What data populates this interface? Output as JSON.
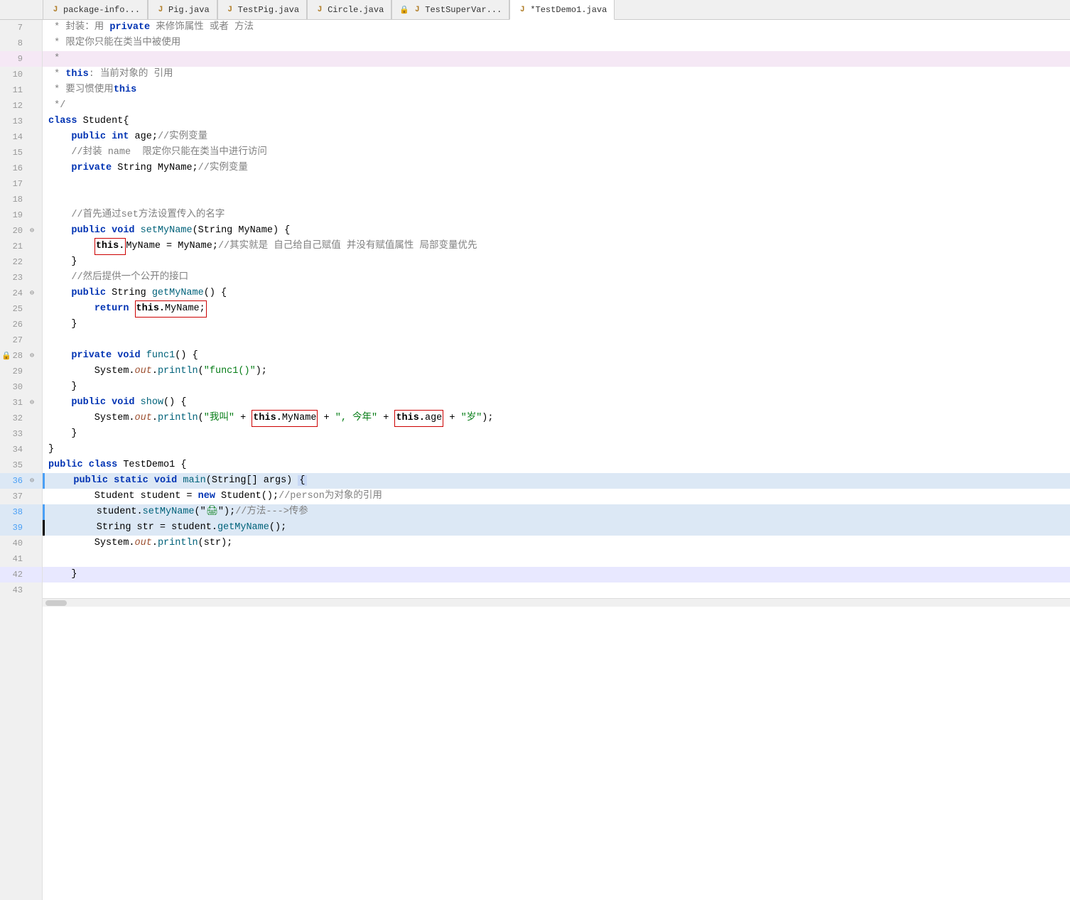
{
  "tabs": [
    {
      "id": "package-info",
      "label": "package-info...",
      "icon": "java",
      "active": false
    },
    {
      "id": "pig-java",
      "label": "Pig.java",
      "icon": "java",
      "active": false
    },
    {
      "id": "testpig-java",
      "label": "TestPig.java",
      "icon": "java",
      "active": false
    },
    {
      "id": "circle-java",
      "label": "Circle.java",
      "icon": "java",
      "active": false
    },
    {
      "id": "testsupervar",
      "label": "TestSuperVar...",
      "icon": "java-lock",
      "active": false
    },
    {
      "id": "testdemo1-java",
      "label": "*TestDemo1.java",
      "icon": "java",
      "active": true
    }
  ],
  "lines": [
    {
      "num": 7,
      "fold": "",
      "content": "comment_line_7",
      "type": "comment"
    },
    {
      "num": 8,
      "fold": "",
      "content": "comment_line_8",
      "type": "comment"
    },
    {
      "num": 9,
      "fold": "",
      "content": "comment_line_9",
      "type": "comment"
    },
    {
      "num": 10,
      "fold": "",
      "content": "comment_line_10",
      "type": "comment"
    },
    {
      "num": 11,
      "fold": "",
      "content": "comment_line_11",
      "type": "comment"
    },
    {
      "num": 12,
      "fold": "",
      "content": "comment_line_12",
      "type": "comment"
    },
    {
      "num": 13,
      "fold": "",
      "content": "code_line_13",
      "type": "code"
    },
    {
      "num": 14,
      "fold": "",
      "content": "code_line_14",
      "type": "code"
    },
    {
      "num": 15,
      "fold": "",
      "content": "code_line_15",
      "type": "comment"
    },
    {
      "num": 16,
      "fold": "",
      "content": "code_line_16",
      "type": "code"
    },
    {
      "num": 17,
      "fold": "",
      "content": "",
      "type": "blank"
    },
    {
      "num": 18,
      "fold": "",
      "content": "",
      "type": "blank"
    },
    {
      "num": 19,
      "fold": "",
      "content": "comment_line_19",
      "type": "comment"
    },
    {
      "num": 20,
      "fold": "⊖",
      "content": "code_line_20",
      "type": "code"
    },
    {
      "num": 21,
      "fold": "",
      "content": "code_line_21",
      "type": "code"
    },
    {
      "num": 22,
      "fold": "",
      "content": "code_line_22",
      "type": "code"
    },
    {
      "num": 23,
      "fold": "",
      "content": "comment_line_23",
      "type": "comment"
    },
    {
      "num": 24,
      "fold": "⊖",
      "content": "code_line_24",
      "type": "code"
    },
    {
      "num": 25,
      "fold": "",
      "content": "code_line_25",
      "type": "code"
    },
    {
      "num": 26,
      "fold": "",
      "content": "code_line_26",
      "type": "code"
    },
    {
      "num": 27,
      "fold": "",
      "content": "",
      "type": "blank"
    },
    {
      "num": 28,
      "fold": "⊖",
      "content": "code_line_28",
      "type": "code",
      "warn": true
    },
    {
      "num": 29,
      "fold": "",
      "content": "code_line_29",
      "type": "code"
    },
    {
      "num": 30,
      "fold": "",
      "content": "code_line_30",
      "type": "code"
    },
    {
      "num": 31,
      "fold": "⊖",
      "content": "code_line_31",
      "type": "code"
    },
    {
      "num": 32,
      "fold": "",
      "content": "code_line_32",
      "type": "code"
    },
    {
      "num": 33,
      "fold": "",
      "content": "code_line_33",
      "type": "code"
    },
    {
      "num": 34,
      "fold": "",
      "content": "code_line_34",
      "type": "code"
    },
    {
      "num": 35,
      "fold": "",
      "content": "code_line_35",
      "type": "code"
    },
    {
      "num": 36,
      "fold": "⊖",
      "content": "code_line_36",
      "type": "code",
      "highlight": true
    },
    {
      "num": 37,
      "fold": "",
      "content": "code_line_37",
      "type": "code"
    },
    {
      "num": 38,
      "fold": "",
      "content": "code_line_38",
      "type": "code",
      "blueline": true
    },
    {
      "num": 39,
      "fold": "",
      "content": "code_line_39",
      "type": "code",
      "blackline": true
    },
    {
      "num": 40,
      "fold": "",
      "content": "code_line_40",
      "type": "code"
    },
    {
      "num": 41,
      "fold": "",
      "content": "",
      "type": "blank"
    },
    {
      "num": 42,
      "fold": "",
      "content": "code_line_42",
      "type": "code",
      "highlight": true
    },
    {
      "num": 43,
      "fold": "",
      "content": "",
      "type": "blank"
    }
  ]
}
